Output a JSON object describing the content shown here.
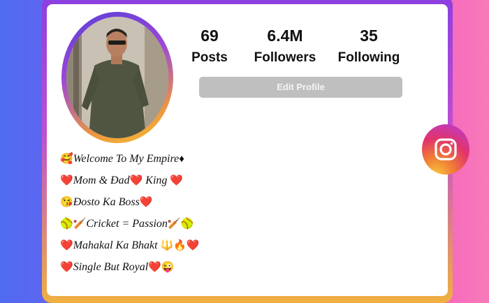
{
  "profile": {
    "stats": [
      {
        "value": "69",
        "label": "Posts"
      },
      {
        "value": "6.4M",
        "label": "Followers"
      },
      {
        "value": "35",
        "label": "Following"
      }
    ],
    "edit_label": "Edit Profile"
  },
  "bio": [
    {
      "lead": "🥰",
      "text": "Welcome To My Empire",
      "trail": "♦"
    },
    {
      "lead": "❤️",
      "text": "Mom & Ɖad",
      "mid": "❤️",
      "text2": " King ",
      "trail": "❤️"
    },
    {
      "lead": "😘",
      "text": "Ɖosto Ka Boss",
      "trail": "❤️"
    },
    {
      "lead": "🥎🏏",
      "text": "Cricket = Passion",
      "trail": "🏏🥎"
    },
    {
      "lead": "❤️",
      "text": "Mahakal Ka Bhakt ",
      "trail": "🔱🔥❤️"
    },
    {
      "lead": "❤️",
      "text": "Single But Royal",
      "trail": "❤️😜"
    }
  ],
  "icons": {
    "instagram": "instagram-icon",
    "avatar": "profile-photo"
  },
  "colors": {
    "instagram_gradient": [
      "#f8c43a",
      "#e2336b",
      "#8b3fd8"
    ],
    "button": "#bfbfbf"
  }
}
